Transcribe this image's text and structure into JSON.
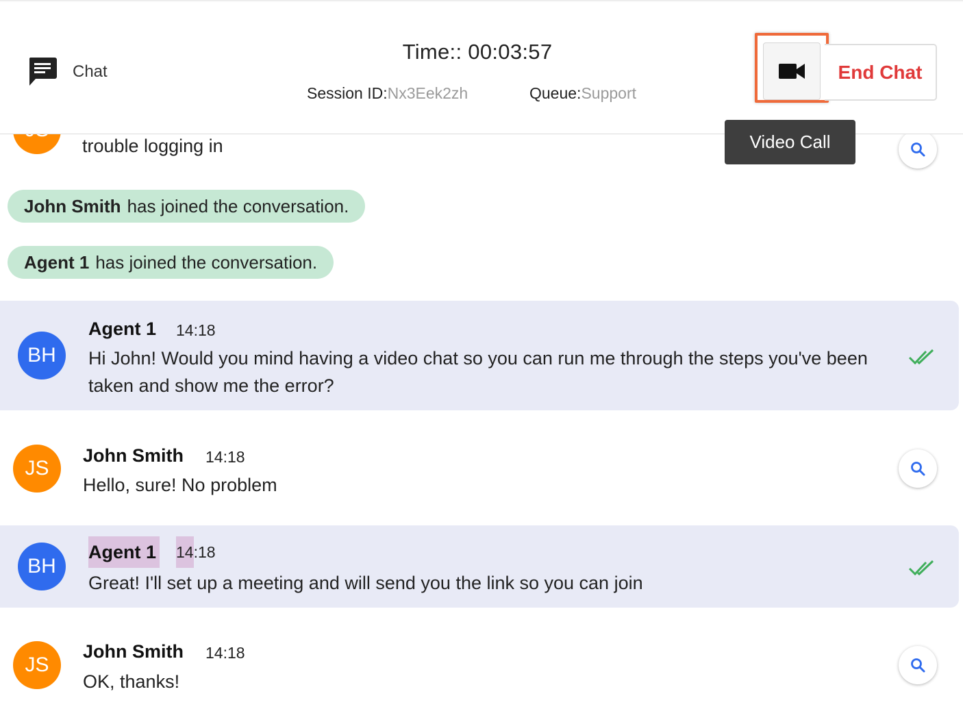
{
  "header": {
    "chat_label": "Chat",
    "timer": "Time:: 00:03:57",
    "session_label": "Session ID:",
    "session_id": "Nx3Eek2zh",
    "queue_label": "Queue:",
    "queue_value": "Support",
    "video_icon": "video-camera-icon",
    "end_chat_label": "End Chat",
    "tooltip": "Video Call"
  },
  "messages": {
    "partial": {
      "avatar": "JS",
      "text": "trouble logging in"
    },
    "system": [
      {
        "name": "John Smith",
        "text": "has joined the conversation."
      },
      {
        "name": "Agent 1",
        "text": "has joined the conversation."
      }
    ],
    "items": [
      {
        "avatar": "BH",
        "author": "Agent 1",
        "time": "14:18",
        "text": "Hi John! Would you mind having a video chat so you can run me through the steps you've been taken and show me the error?"
      },
      {
        "avatar": "JS",
        "author": "John Smith",
        "time": "14:18",
        "text": "Hello, sure! No problem"
      },
      {
        "avatar": "BH",
        "author": "Agent 1",
        "time_a": "14",
        "time_b": ":18",
        "text": "Great! I'll set up a meeting and will send you the link so you can join"
      },
      {
        "avatar": "JS",
        "author": "John Smith",
        "time": "14:18",
        "text": "OK, thanks!"
      }
    ]
  },
  "colors": {
    "agent_bubble": "#e8eaf6",
    "system_pill": "#c6e8d4",
    "customer_avatar": "#ff8a00",
    "agent_avatar": "#2f6bee",
    "end_chat": "#e03a3a",
    "highlight_box": "#ef6a3a",
    "read_check": "#3fae5a",
    "search_icon": "#2f6bee"
  }
}
